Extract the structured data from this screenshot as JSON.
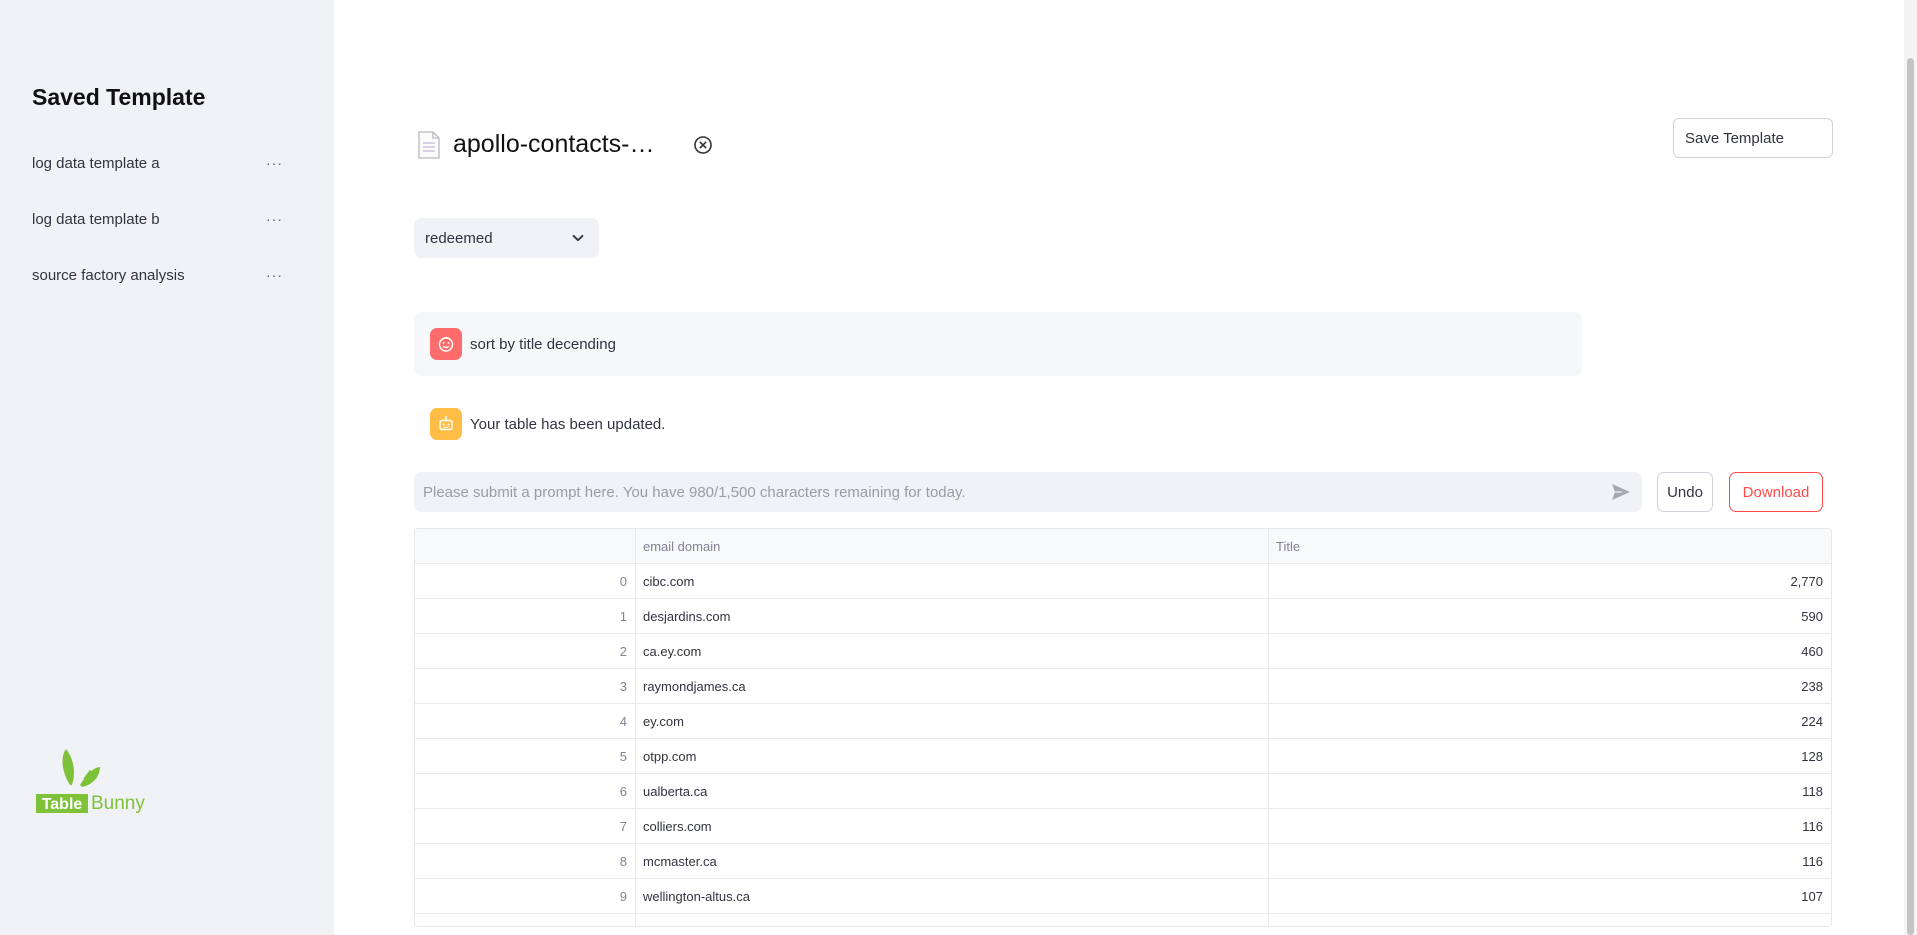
{
  "sidebar": {
    "title": "Saved Template",
    "templates": [
      {
        "label": "log data template a",
        "more": "···"
      },
      {
        "label": "log data template b",
        "more": "···"
      },
      {
        "label": "source factory analysis",
        "more": "···"
      }
    ],
    "logo": {
      "word1": "Table",
      "word2": "Bunny",
      "icon": "bunny-ears-icon"
    }
  },
  "file": {
    "name": "apollo-contacts-export.csv",
    "icon": "document-icon",
    "close_icon": "close-circle-icon"
  },
  "toolbar": {
    "save_template": "Save Template"
  },
  "select": {
    "value": "redeemed",
    "icon": "chevron-down-icon"
  },
  "chat": {
    "user_message": "sort by title decending",
    "bot_message": "Your table has been updated."
  },
  "prompt": {
    "placeholder": "Please submit a prompt here. You have 980/1,500 characters remaining for today.",
    "value": ""
  },
  "buttons": {
    "undo": "Undo",
    "download": "Download"
  },
  "table": {
    "columns": [
      "",
      "email domain",
      "Title"
    ],
    "rows": [
      [
        "0",
        "cibc.com",
        "2,770"
      ],
      [
        "1",
        "desjardins.com",
        "590"
      ],
      [
        "2",
        "ca.ey.com",
        "460"
      ],
      [
        "3",
        "raymondjames.ca",
        "238"
      ],
      [
        "4",
        "ey.com",
        "224"
      ],
      [
        "5",
        "otpp.com",
        "128"
      ],
      [
        "6",
        "ualberta.ca",
        "118"
      ],
      [
        "7",
        "colliers.com",
        "116"
      ],
      [
        "8",
        "mcmaster.ca",
        "116"
      ],
      [
        "9",
        "wellington-altus.ca",
        "107"
      ]
    ]
  },
  "colors": {
    "accent": "#ff4b4b",
    "user_avatar": "#ff6c6c",
    "bot_avatar": "#ffbd45",
    "logo_green": "#7ec23a",
    "sidebar_bg": "#f0f2f6"
  }
}
